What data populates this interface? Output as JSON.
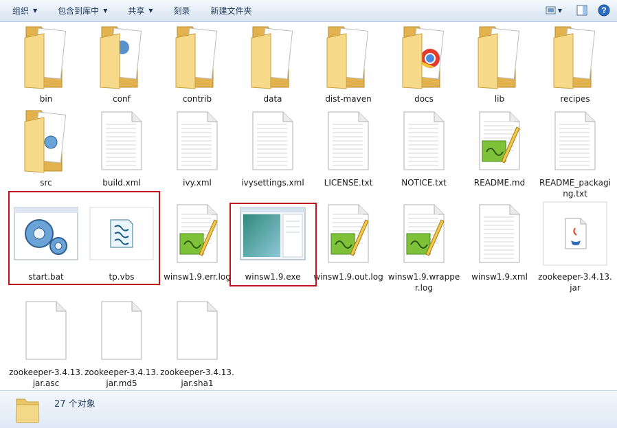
{
  "toolbar": {
    "organize": "组织",
    "include_in_library": "包含到库中",
    "share": "共享",
    "burn": "刻录",
    "new_folder": "新建文件夹"
  },
  "icons": {
    "view": "view-options-icon",
    "preview_pane": "preview-pane-icon",
    "help": "help-icon"
  },
  "files": [
    {
      "name": "bin",
      "type": "folder"
    },
    {
      "name": "conf",
      "type": "folder"
    },
    {
      "name": "contrib",
      "type": "folder"
    },
    {
      "name": "data",
      "type": "folder"
    },
    {
      "name": "dist-maven",
      "type": "folder"
    },
    {
      "name": "docs",
      "type": "folder"
    },
    {
      "name": "lib",
      "type": "folder"
    },
    {
      "name": "recipes",
      "type": "folder"
    },
    {
      "name": "src",
      "type": "folder"
    },
    {
      "name": "build.xml",
      "type": "text"
    },
    {
      "name": "ivy.xml",
      "type": "text"
    },
    {
      "name": "ivysettings.xml",
      "type": "text"
    },
    {
      "name": "LICENSE.txt",
      "type": "text"
    },
    {
      "name": "NOTICE.txt",
      "type": "text"
    },
    {
      "name": "README.md",
      "type": "notepad"
    },
    {
      "name": "README_packaging.txt",
      "type": "text"
    },
    {
      "name": "start.bat",
      "type": "bat"
    },
    {
      "name": "tp.vbs",
      "type": "vbs"
    },
    {
      "name": "winsw1.9.err.log",
      "type": "notepad"
    },
    {
      "name": "winsw1.9.exe",
      "type": "exe"
    },
    {
      "name": "winsw1.9.out.log",
      "type": "notepad"
    },
    {
      "name": "winsw1.9.wrapper.log",
      "type": "notepad"
    },
    {
      "name": "winsw1.9.xml",
      "type": "text"
    },
    {
      "name": "zookeeper-3.4.13.jar",
      "type": "jar"
    },
    {
      "name": "zookeeper-3.4.13.jar.asc",
      "type": "blank"
    },
    {
      "name": "zookeeper-3.4.13.jar.md5",
      "type": "blank"
    },
    {
      "name": "zookeeper-3.4.13.jar.sha1",
      "type": "blank"
    }
  ],
  "status": {
    "count": "27 个对象"
  },
  "colors": {
    "highlight": "#c0141c",
    "toolbar_text": "#1e395b"
  }
}
